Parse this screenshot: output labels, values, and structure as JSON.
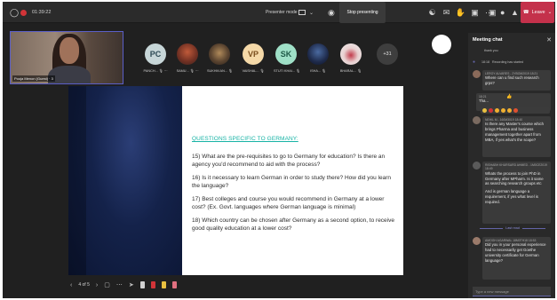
{
  "topbar": {
    "timer": "01:39:22",
    "presenter_mode": "Presenter mode",
    "stop_presenting": "Stop presenting",
    "leave": "Leave"
  },
  "self_video": {
    "name": "Pooja Menon (Guest) · 3"
  },
  "participants": [
    {
      "initials": "PC",
      "name": "PANCH... 🎙 ⋯",
      "color": "#c7d6d8"
    },
    {
      "initials": "",
      "name": "SAMU... 🎙 ⋯",
      "color": "#7a4a3a"
    },
    {
      "initials": "",
      "name": "SUKHM AN... 🎙",
      "color": "#5a4a38"
    },
    {
      "initials": "VP",
      "name": "VAISHAL... 🎙",
      "color": "#f5d9a8"
    },
    {
      "initials": "SK",
      "name": "STUTI KHAI... 🎙",
      "color": "#9fe0c7"
    },
    {
      "initials": "",
      "name": "ISHA... 🎙",
      "color": "#1e2a4a"
    },
    {
      "initials": "",
      "name": "BHARAL... 🎙",
      "color": "#e0e0e0"
    }
  ],
  "more_count": "+31",
  "slide": {
    "heading": "QUESTIONS SPECIFIC TO GERMANY:",
    "q15": "15) What are the pre-requisites to go to Germany for education? Is there an agency you'd recommend to aid with the process?",
    "q16": "16) Is it necessary to learn German in order to study there? How did you learn the language?",
    "q17": "17) Best colleges and course you would recommend in Germany at a lower cost? (Ex. Govt. languages where German language is minimal)",
    "q18": "18) Which country can be chosen after Germany as a second option, to receive good quality education at a lower cost?"
  },
  "bottom_bar": {
    "page_counter": "4 of 5"
  },
  "chat": {
    "title": "Meeting chat",
    "thank_you": "thank you",
    "recording_meta": "18:18",
    "recording_text": "Recording has started",
    "m1_meta": "LEROY ALVARES - 2YBOM2019 18:21",
    "m1_text": "Where can u find such research grps?",
    "m2_meta": "18:21",
    "m2_text": "Tha...",
    "m3_meta": "NEHIL M - 160M3019 18:40",
    "m3_text": "Is there any Master's course which brings Pharma and business management together apart from MBA, if yes what's the scope?",
    "m4_meta": "RISHABH KHURSARD AHMED - 1M0CE2019 18:49",
    "m4_text": "Whats the process to join PhD in Germany after MPharm. Is it same as searching research groups etc",
    "m4_text2": "And is german language a requirement, if yes what level is required.",
    "last_read": "Last read",
    "m5_meta": "AMOGH AGARWAL 18M0TH18 18:53",
    "m5_text": "Did you in your personal experience had to necessarily get Goethe university certificate for German language?",
    "compose_placeholder": "Type a new message"
  }
}
